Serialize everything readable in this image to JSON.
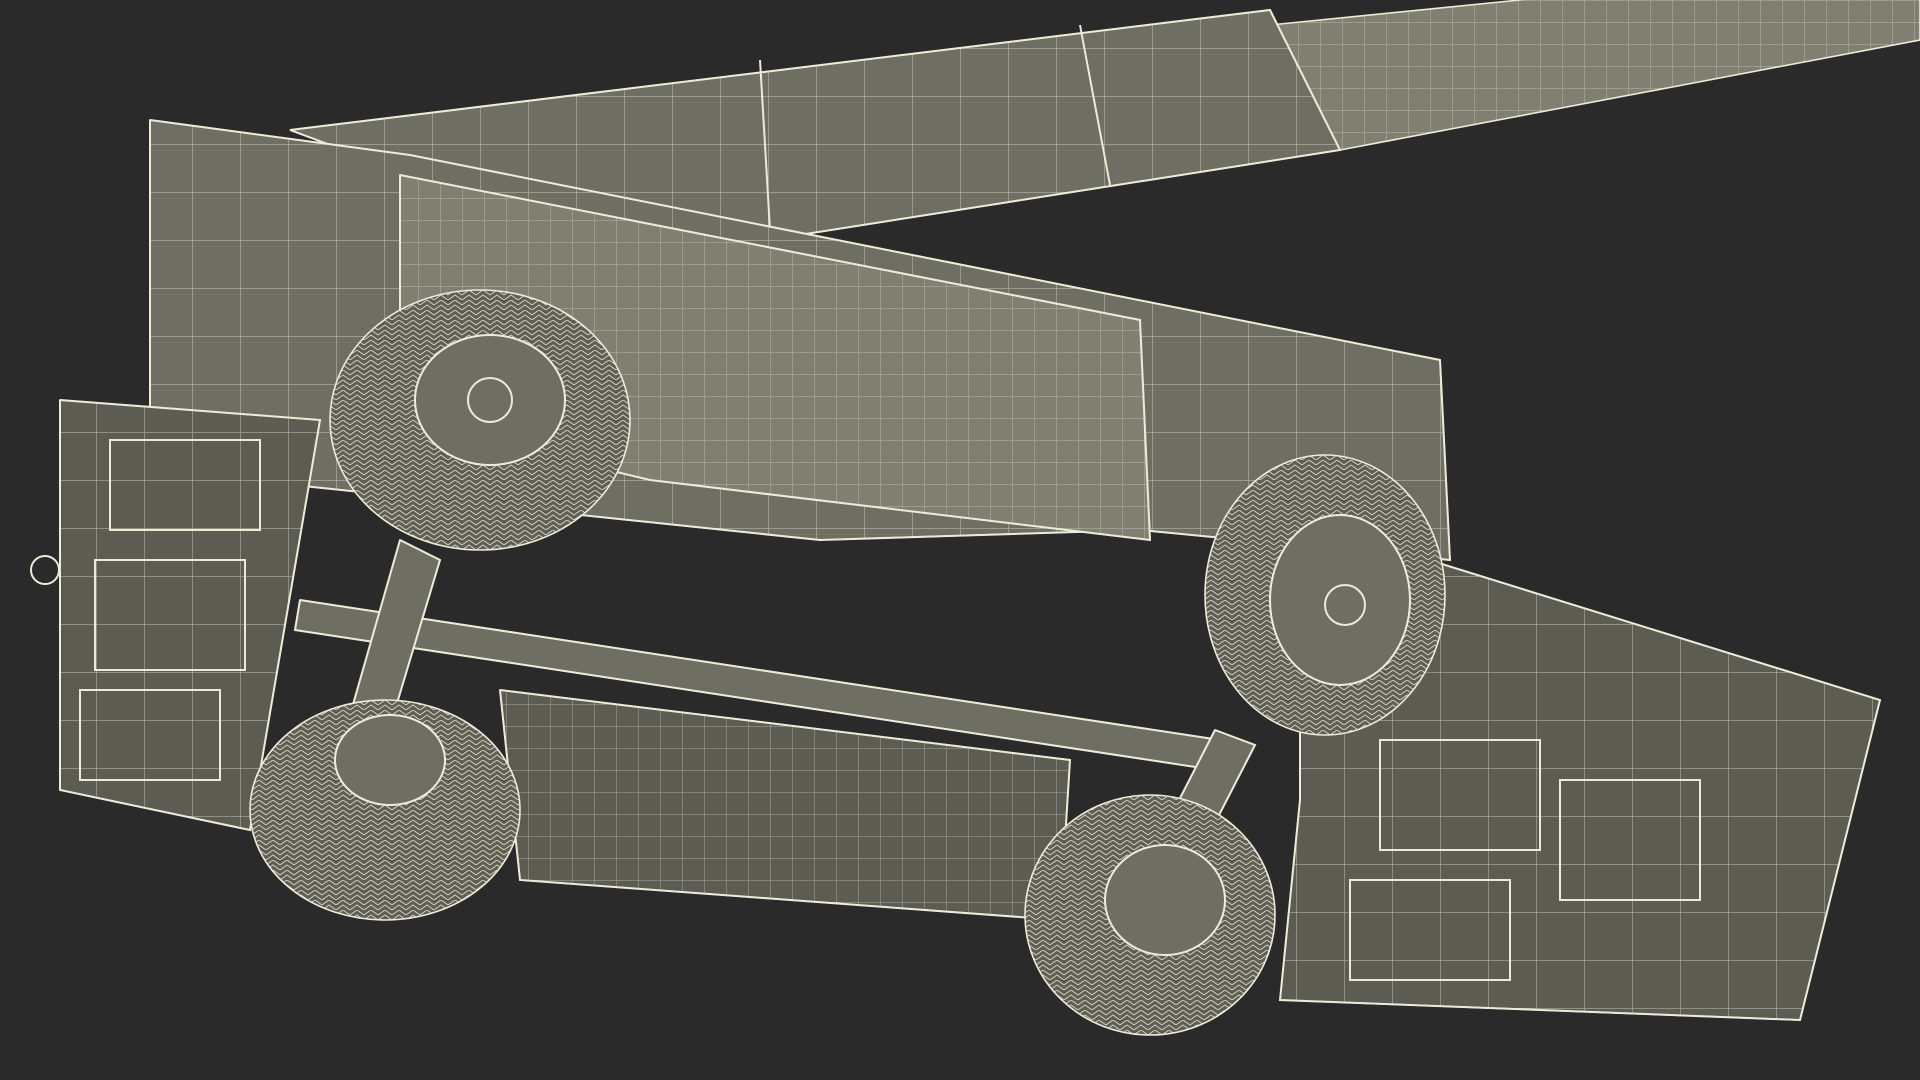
{
  "scene": {
    "subject": "wireframe-vehicle-render",
    "colors": {
      "background": "#2a2a2a",
      "surface": "#6f6e62",
      "surface_dark": "#5d5c52",
      "surface_light": "#807f72",
      "wire": "#ecebd8",
      "wire_faint": "#d9d8c4",
      "tire": "#5f5e55"
    }
  }
}
